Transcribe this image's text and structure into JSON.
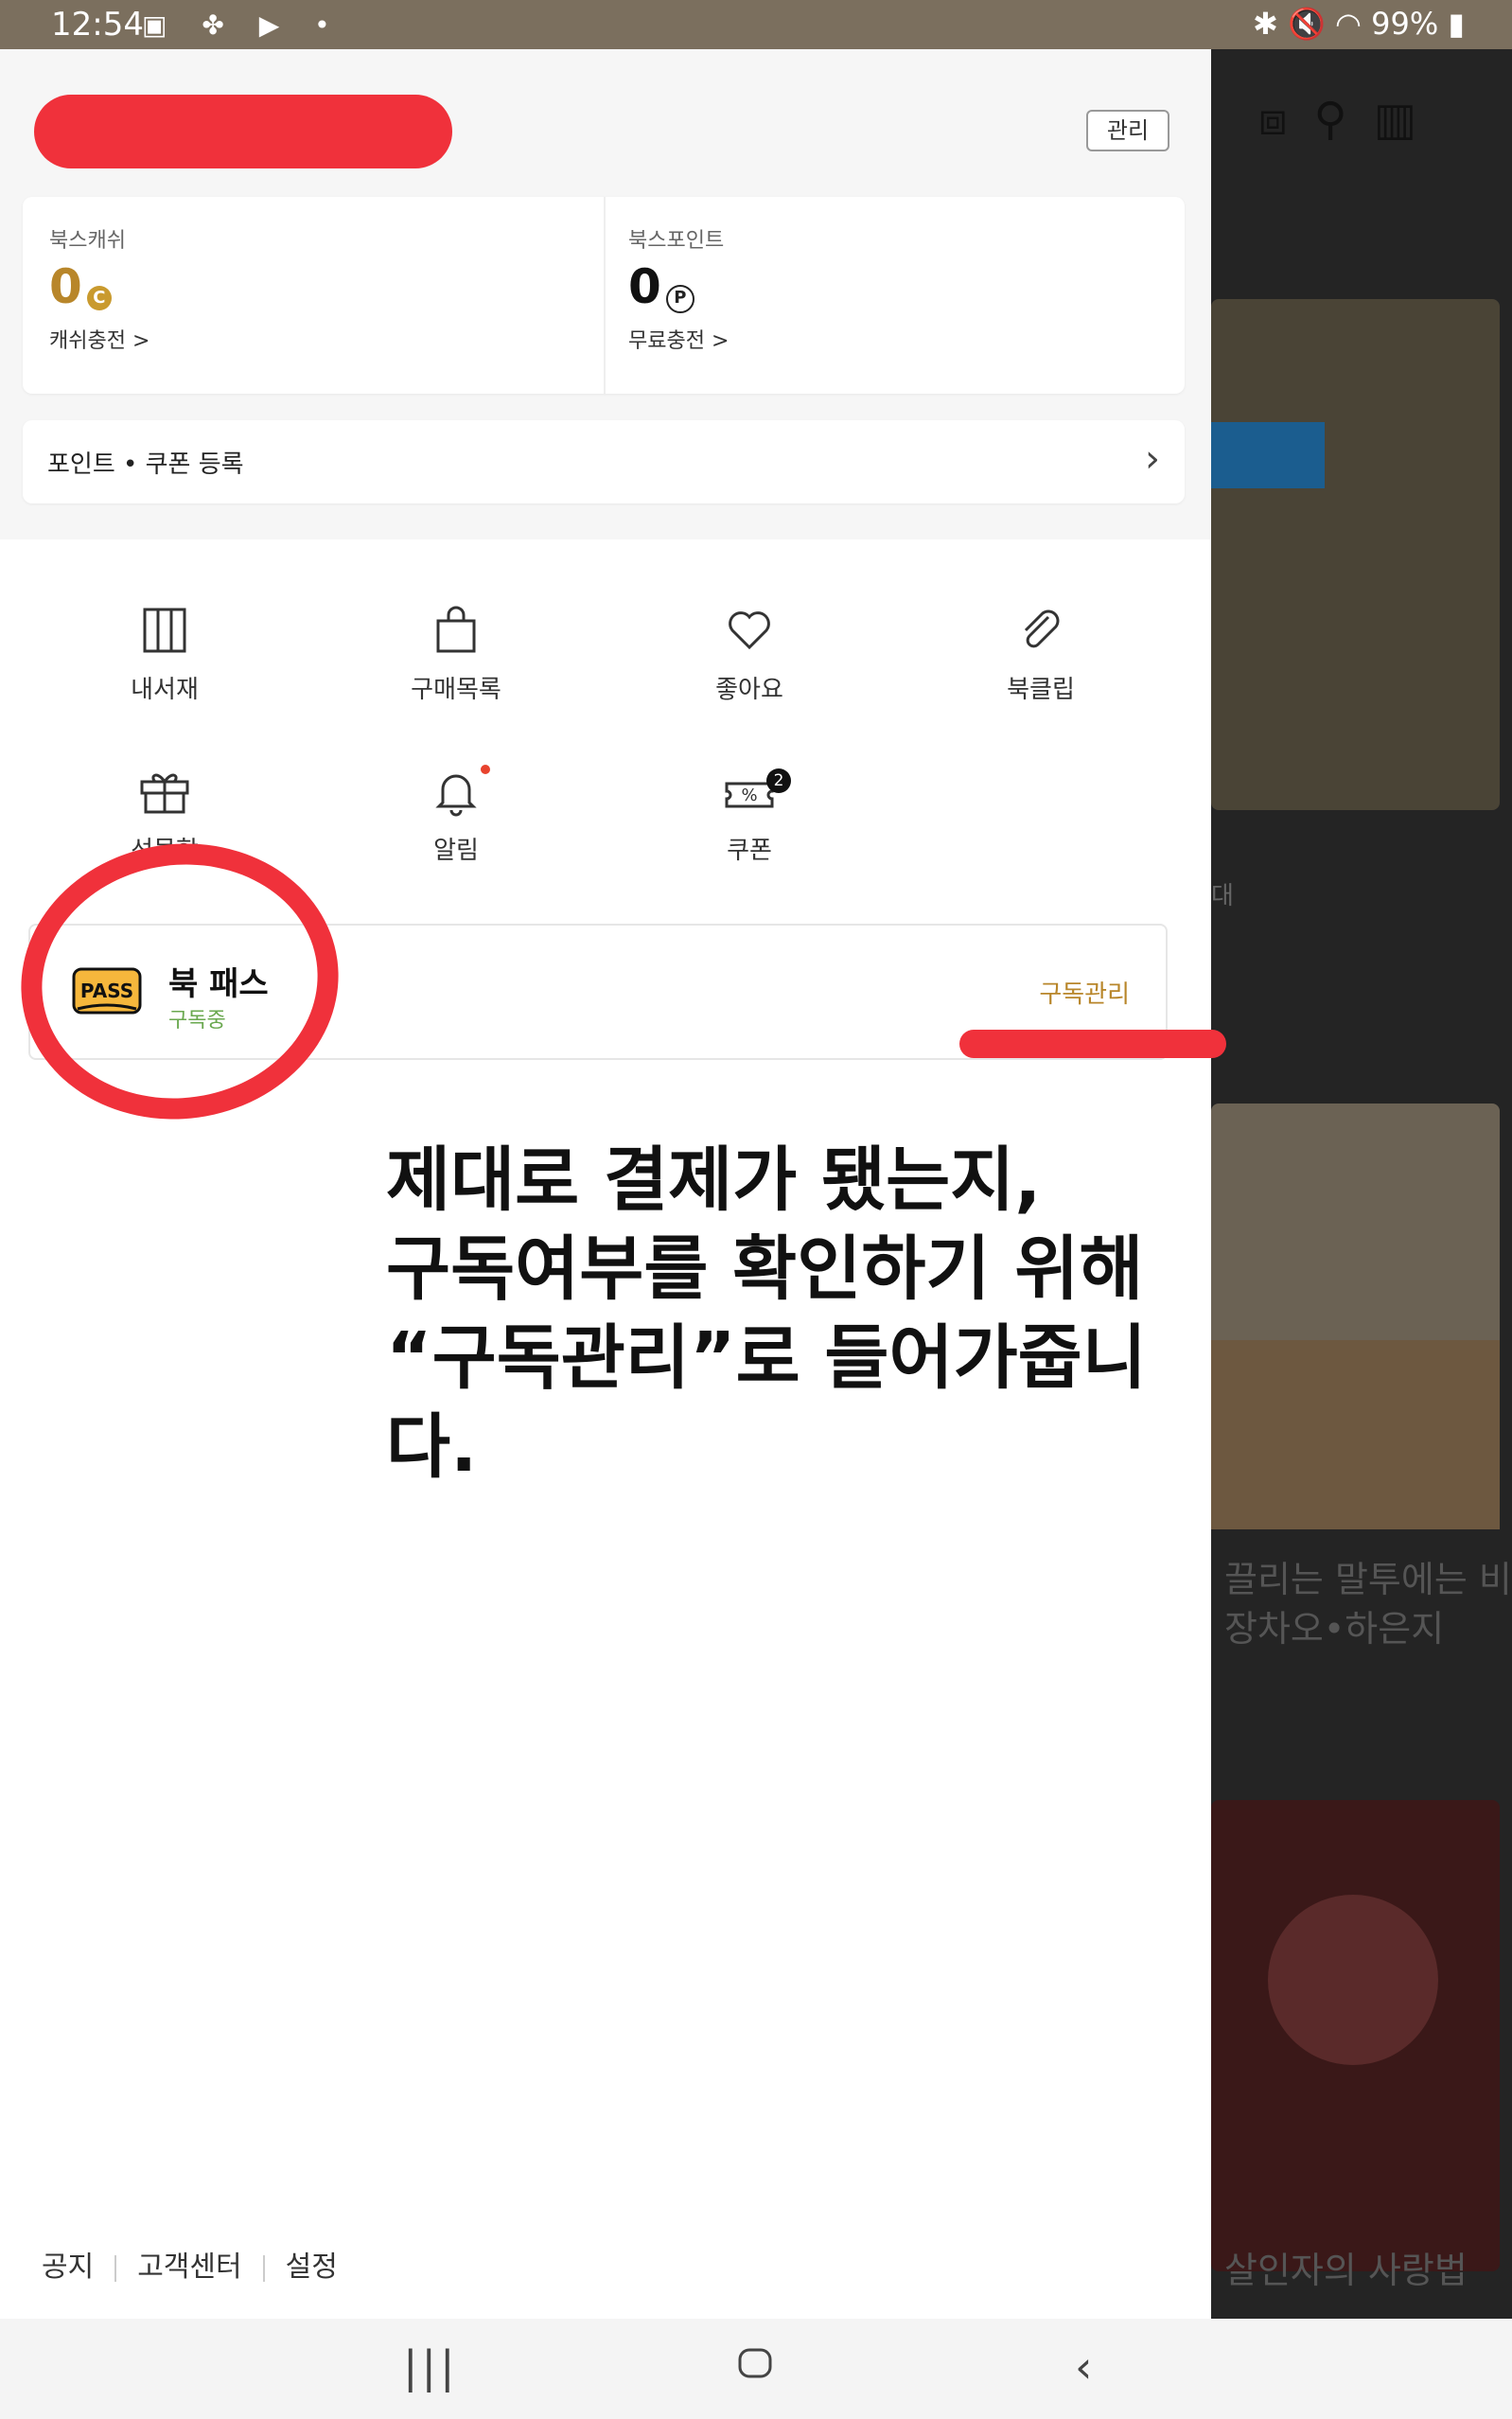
{
  "status_bar": {
    "time": "12:54",
    "battery": "99%",
    "left_icons": [
      "image-icon",
      "pinwheel-icon",
      "youtube-icon",
      "dot-icon"
    ]
  },
  "drawer": {
    "manage_button": "관리",
    "wallet": {
      "cash": {
        "label": "북스캐쉬",
        "value": "0",
        "unit": "C",
        "link": "캐쉬충전 >"
      },
      "point": {
        "label": "북스포인트",
        "value": "0",
        "unit": "P",
        "link": "무료충전 >"
      }
    },
    "coupon_register": {
      "label": "포인트 • 쿠폰 등록"
    },
    "menu": [
      {
        "label": "내서재",
        "icon": "bookshelf-icon"
      },
      {
        "label": "구매목록",
        "icon": "shopping-bag-icon"
      },
      {
        "label": "좋아요",
        "icon": "heart-icon"
      },
      {
        "label": "북클립",
        "icon": "paperclip-icon"
      },
      {
        "label": "선물함",
        "icon": "gift-icon"
      },
      {
        "label": "알림",
        "icon": "bell-icon"
      },
      {
        "label": "쿠폰",
        "icon": "coupon-icon",
        "badge": "2"
      }
    ],
    "pass": {
      "badge_text": "PASS",
      "title": "북 패스",
      "status": "구독중",
      "manage": "구독관리"
    },
    "annotation": [
      "제대로 결제가 됐는지,",
      "구독여부를 확인하기 위해",
      "“구독관리”로 들어가줍니다."
    ],
    "footer": [
      "공지",
      "고객센터",
      "설정"
    ]
  },
  "background_app": {
    "partial_label": "대",
    "book1_title": "끌리는 말투에는 비밀",
    "book1_author": "장차오•하은지",
    "book2_title": "살인자의 사랑법"
  },
  "colors": {
    "accent_gold": "#b8862a",
    "annotation_red": "#f0313b",
    "subscribed_green": "#6aa84f"
  }
}
